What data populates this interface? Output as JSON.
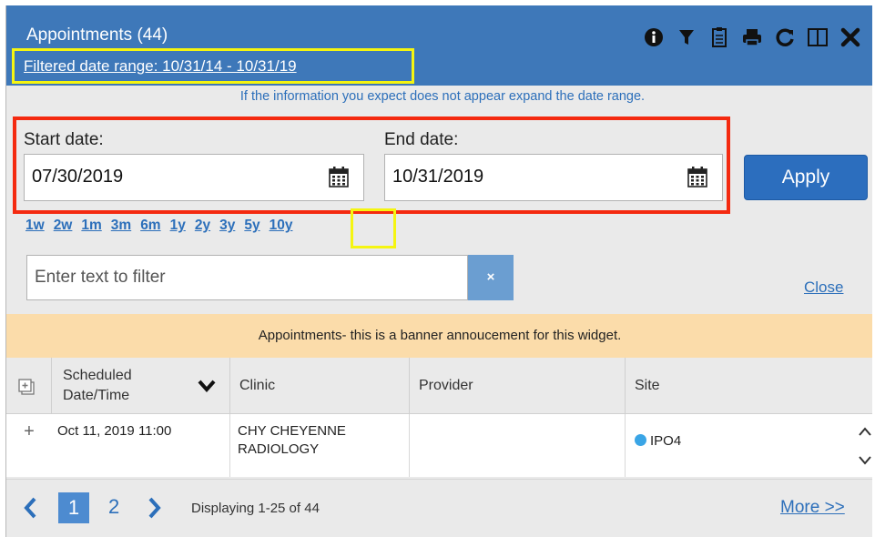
{
  "header": {
    "title": "Appointments (44)",
    "date_range": "Filtered date range: 10/31/14 - 10/31/19",
    "toolbar": {
      "icons": [
        "info-icon",
        "filter-icon",
        "clipboard-icon",
        "print-icon",
        "refresh-icon",
        "columns-icon",
        "close-icon"
      ]
    }
  },
  "info_message": "If the information you expect does not appear expand the date range.",
  "date_filter": {
    "start_label": "Start date:",
    "start_value": "07/30/2019",
    "end_label": "End date:",
    "end_value": "10/31/2019",
    "apply_label": "Apply"
  },
  "quick_ranges": [
    "1w",
    "2w",
    "1m",
    "3m",
    "6m",
    "1y",
    "2y",
    "3y",
    "5y",
    "10y"
  ],
  "text_filter": {
    "placeholder": "Enter text to filter",
    "clear_label": "×",
    "close_label": "Close"
  },
  "banner": "Appointments- this is a banner annoucement for this widget.",
  "table": {
    "columns": [
      "Scheduled Date/Time",
      "Clinic",
      "Provider",
      "Site"
    ],
    "rows": [
      {
        "expand": "+",
        "datetime": "Oct 11, 2019 11:00",
        "clinic_line1": "CHY CHEYENNE",
        "clinic_line2": "RADIOLOGY",
        "provider": "",
        "site": "IPO4"
      }
    ]
  },
  "pagination": {
    "pages": [
      "1",
      "2"
    ],
    "current_page": "1",
    "status": "Displaying 1-25 of 44",
    "more_label": "More >>"
  },
  "colors": {
    "header_bg": "#3e78b9",
    "highlight_yellow": "#f5f511",
    "highlight_red": "#f42a10",
    "banner_bg": "#fbdcaa",
    "link_blue": "#2c6fba",
    "site_dot": "#3aa5e6"
  }
}
